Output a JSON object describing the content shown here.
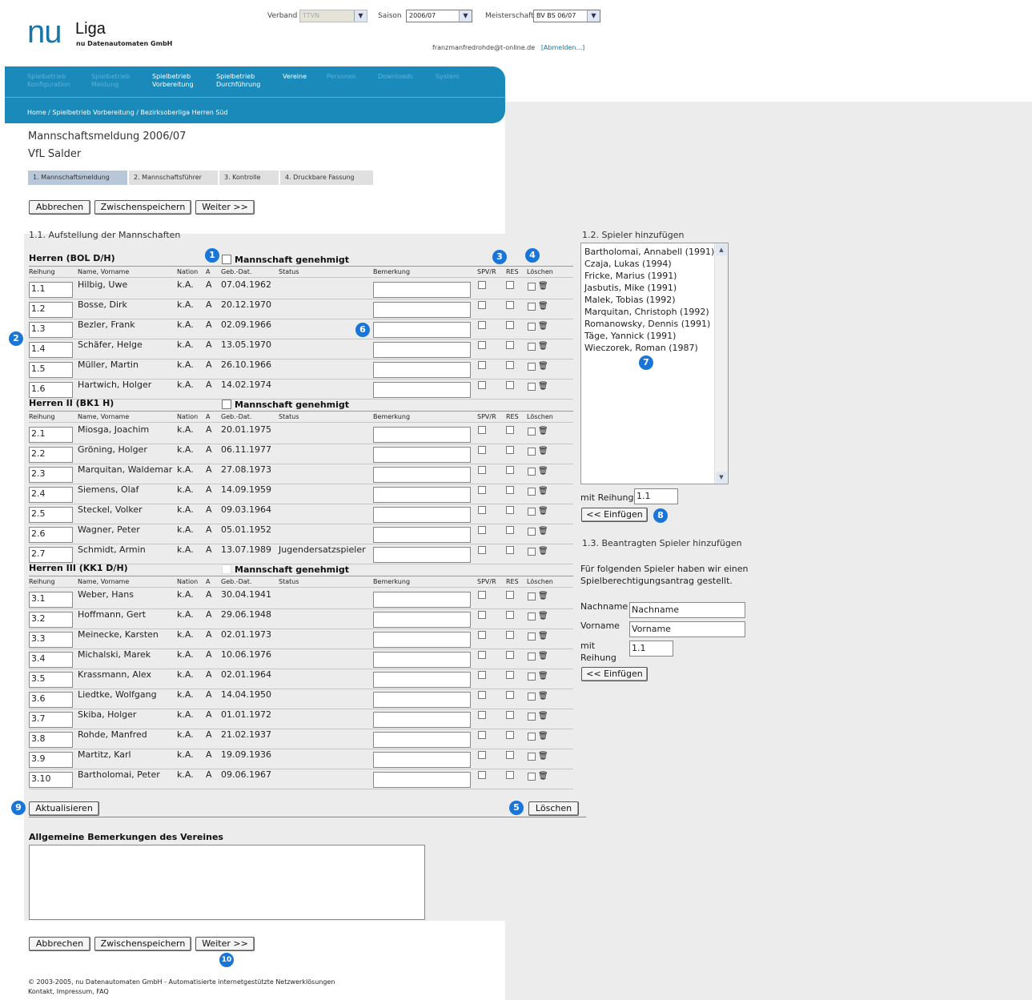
{
  "header": {
    "logo_nu": "nu",
    "logo_liga": "Liga",
    "logo_sub": "nu Datenautomaten GmbH",
    "verband_label": "Verband",
    "verband_value": "TTVN",
    "saison_label": "Saison",
    "saison_value": "2006/07",
    "meisterschaft_label": "Meisterschaft",
    "meisterschaft_value": "BV BS 06/07",
    "user_email": "franzmanfredrohde@t-online.de",
    "logout": "[Abmelden...]"
  },
  "nav": {
    "items": [
      {
        "l1": "Spielbetrieb",
        "l2": "Konfiguration"
      },
      {
        "l1": "Spielbetrieb",
        "l2": "Meldung"
      },
      {
        "l1": "Spielbetrieb",
        "l2": "Vorbereitung"
      },
      {
        "l1": "Spielbetrieb",
        "l2": "Durchführung"
      },
      {
        "l1": "Vereine",
        "l2": ""
      },
      {
        "l1": "Personen",
        "l2": ""
      },
      {
        "l1": "Downloads",
        "l2": ""
      },
      {
        "l1": "System",
        "l2": ""
      }
    ],
    "breadcrumb": "Home / Spielbetrieb Vorbereitung / Bezirksoberliga Herren Süd"
  },
  "page": {
    "title": "Mannschaftsmeldung 2006/07",
    "club": "VfL Salder",
    "steps": [
      "1. Mannschaftsmeldung",
      "2. Mannschaftsführer",
      "3. Kontrolle",
      "4. Druckbare Fassung"
    ],
    "btn_cancel": "Abbrechen",
    "btn_save": "Zwischenspeichern",
    "btn_next": "Weiter >>",
    "section_title": "1.1. Aufstellung der Mannschaften",
    "genehmigt": "Mannschaft genehmigt",
    "columns": [
      "Reihung",
      "Name, Vorname",
      "Nation",
      "A",
      "Geb.-Dat.",
      "Status",
      "Bemerkung",
      "SPV/R",
      "RES",
      "Löschen"
    ],
    "btn_update": "Aktualisieren",
    "btn_delete": "Löschen",
    "remarks_title": "Allgemeine Bemerkungen des Vereines"
  },
  "teams": [
    {
      "name": "Herren (BOL D/H)",
      "players": [
        {
          "rank": "1.1",
          "name": "Hilbig, Uwe",
          "nation": "k.A.",
          "a": "A",
          "dob": "07.04.1962",
          "status": ""
        },
        {
          "rank": "1.2",
          "name": "Bosse, Dirk",
          "nation": "k.A.",
          "a": "A",
          "dob": "20.12.1970",
          "status": ""
        },
        {
          "rank": "1.3",
          "name": "Bezler, Frank",
          "nation": "k.A.",
          "a": "A",
          "dob": "02.09.1966",
          "status": ""
        },
        {
          "rank": "1.4",
          "name": "Schäfer, Helge",
          "nation": "k.A.",
          "a": "A",
          "dob": "13.05.1970",
          "status": ""
        },
        {
          "rank": "1.5",
          "name": "Müller, Martin",
          "nation": "k.A.",
          "a": "A",
          "dob": "26.10.1966",
          "status": ""
        },
        {
          "rank": "1.6",
          "name": "Hartwich, Holger",
          "nation": "k.A.",
          "a": "A",
          "dob": "14.02.1974",
          "status": ""
        }
      ]
    },
    {
      "name": "Herren II (BK1 H)",
      "players": [
        {
          "rank": "2.1",
          "name": "Miosga, Joachim",
          "nation": "k.A.",
          "a": "A",
          "dob": "20.01.1975",
          "status": ""
        },
        {
          "rank": "2.2",
          "name": "Gröning, Holger",
          "nation": "k.A.",
          "a": "A",
          "dob": "06.11.1977",
          "status": ""
        },
        {
          "rank": "2.3",
          "name": "Marquitan, Waldemar",
          "nation": "k.A.",
          "a": "A",
          "dob": "27.08.1973",
          "status": ""
        },
        {
          "rank": "2.4",
          "name": "Siemens, Olaf",
          "nation": "k.A.",
          "a": "A",
          "dob": "14.09.1959",
          "status": ""
        },
        {
          "rank": "2.5",
          "name": "Steckel, Volker",
          "nation": "k.A.",
          "a": "A",
          "dob": "09.03.1964",
          "status": ""
        },
        {
          "rank": "2.6",
          "name": "Wagner, Peter",
          "nation": "k.A.",
          "a": "A",
          "dob": "05.01.1952",
          "status": ""
        },
        {
          "rank": "2.7",
          "name": "Schmidt, Armin",
          "nation": "k.A.",
          "a": "A",
          "dob": "13.07.1989",
          "status": "Jugendersatzspieler"
        }
      ]
    },
    {
      "name": "Herren III (KK1 D/H)",
      "players": [
        {
          "rank": "3.1",
          "name": "Weber, Hans",
          "nation": "k.A.",
          "a": "A",
          "dob": "30.04.1941",
          "status": ""
        },
        {
          "rank": "3.2",
          "name": "Hoffmann, Gert",
          "nation": "k.A.",
          "a": "A",
          "dob": "29.06.1948",
          "status": ""
        },
        {
          "rank": "3.3",
          "name": "Meinecke, Karsten",
          "nation": "k.A.",
          "a": "A",
          "dob": "02.01.1973",
          "status": ""
        },
        {
          "rank": "3.4",
          "name": "Michalski, Marek",
          "nation": "k.A.",
          "a": "A",
          "dob": "10.06.1976",
          "status": ""
        },
        {
          "rank": "3.5",
          "name": "Krassmann, Alex",
          "nation": "k.A.",
          "a": "A",
          "dob": "02.01.1964",
          "status": ""
        },
        {
          "rank": "3.6",
          "name": "Liedtke, Wolfgang",
          "nation": "k.A.",
          "a": "A",
          "dob": "14.04.1950",
          "status": ""
        },
        {
          "rank": "3.7",
          "name": "Skiba, Holger",
          "nation": "k.A.",
          "a": "A",
          "dob": "01.01.1972",
          "status": ""
        },
        {
          "rank": "3.8",
          "name": "Rohde, Manfred",
          "nation": "k.A.",
          "a": "A",
          "dob": "21.02.1937",
          "status": ""
        },
        {
          "rank": "3.9",
          "name": "Martitz, Karl",
          "nation": "k.A.",
          "a": "A",
          "dob": "19.09.1936",
          "status": ""
        },
        {
          "rank": "3.10",
          "name": "Bartholomai, Peter",
          "nation": "k.A.",
          "a": "A",
          "dob": "09.06.1967",
          "status": ""
        }
      ]
    }
  ],
  "add_player": {
    "title": "1.2. Spieler hinzufügen",
    "list": [
      "Bartholomai, Annabell (1991)",
      "Czaja, Lukas (1994)",
      "Fricke, Marius (1991)",
      "Jasbutis, Mike (1991)",
      "Malek, Tobias (1992)",
      "Marquitan, Christoph (1992)",
      "Romanowsky, Dennis (1991)",
      "Täge, Yannick (1991)",
      "Wieczorek, Roman (1987)"
    ],
    "reihung_label": "mit Reihung",
    "reihung_value": "1.1",
    "btn_insert": "<< Einfügen"
  },
  "requested_player": {
    "title": "1.3. Beantragten Spieler hinzufügen",
    "info_l1": "Für folgenden Spieler haben wir einen",
    "info_l2": "Spielberechtigungsantrag gestellt.",
    "nachname_label": "Nachname",
    "nachname_value": "Nachname",
    "vorname_label": "Vorname",
    "vorname_value": "Vorname",
    "mit_label": "mit",
    "reihung_label": "Reihung",
    "reihung_value": "1.1",
    "btn_insert": "<< Einfügen"
  },
  "markers": [
    "1",
    "2",
    "3",
    "4",
    "5",
    "6",
    "7",
    "8",
    "9",
    "10"
  ],
  "footer": {
    "line1": "© 2003-2005, nu Datenautomaten GmbH - Automatisierte internetgestützte Netzwerklösungen",
    "line2": "Kontakt, Impressum, FAQ"
  },
  "colors": {
    "brand": "#1a8aba",
    "marker": "#1976d8"
  }
}
